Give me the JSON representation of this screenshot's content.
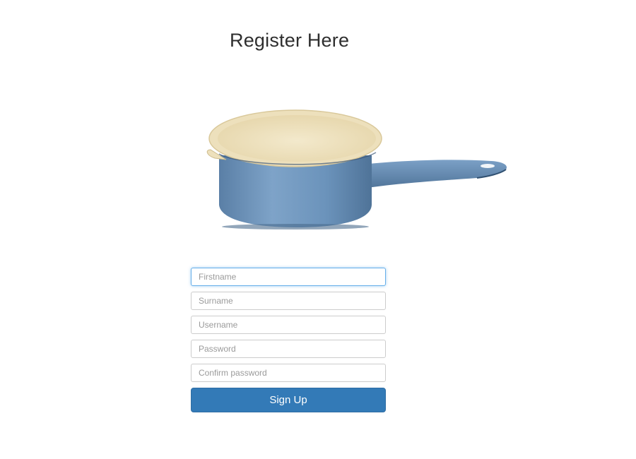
{
  "page": {
    "title": "Register Here"
  },
  "image": {
    "alt": "Blue enamel saucepan with cream interior and long handle",
    "colors": {
      "enamel_blue": "#6b93bb",
      "cream": "#efe3c2"
    }
  },
  "form": {
    "firstname_placeholder": "Firstname",
    "surname_placeholder": "Surname",
    "username_placeholder": "Username",
    "password_placeholder": "Password",
    "confirm_password_placeholder": "Confirm password",
    "signup_label": "Sign Up"
  },
  "colors": {
    "button_bg": "#337ab7",
    "focus_border": "#66afe9"
  }
}
